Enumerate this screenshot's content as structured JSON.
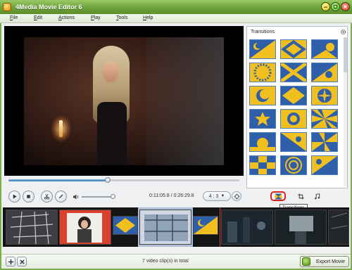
{
  "window": {
    "title": "4Media Movie Editor 6"
  },
  "menu": [
    {
      "label": "File"
    },
    {
      "label": "Edit"
    },
    {
      "label": "Actions"
    },
    {
      "label": "Play"
    },
    {
      "label": "Tools"
    },
    {
      "label": "Help"
    }
  ],
  "player": {
    "progress": 0.43,
    "volume": 0.95,
    "timecode": "0:11:05.8 / 0:26:29.8",
    "aspect_ratio": "4 : 3"
  },
  "panel": {
    "title": "Transitions",
    "transition_count": 24
  },
  "tabs": [
    {
      "icon": "transitions-icon",
      "active": true
    },
    {
      "icon": "crop-icon",
      "active": false
    },
    {
      "icon": "music-icon",
      "active": false
    }
  ],
  "tooltip": "Transitions",
  "status": {
    "clip_count_text": "7 video clip(s) in total",
    "export_label": "Export Movie"
  },
  "colors": {
    "accent_green": "#6ea23a",
    "transition_blue": "#2f5fa8",
    "transition_yellow": "#f2c01e",
    "active_tab_outline": "#e02020"
  }
}
